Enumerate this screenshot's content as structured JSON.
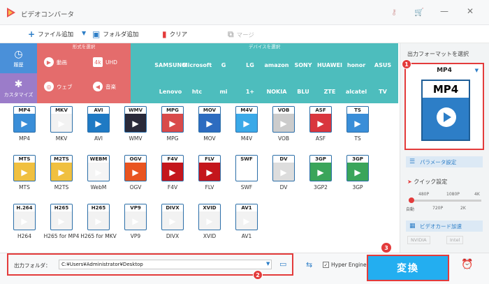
{
  "app": {
    "title": "ビデオコンバータ"
  },
  "toolbar": {
    "add_file": "ファイル追加",
    "add_folder": "フォルダ追加",
    "clear": "クリア",
    "merge": "マージ"
  },
  "side": {
    "history": "履歴",
    "custom": "カスタマイズ",
    "format_header": "形式を選択",
    "device_header": "デバイスを選択",
    "cats": [
      "動画",
      "UHD",
      "ウェブ",
      "音楽"
    ]
  },
  "brands": [
    [
      "",
      "SAMSUNG",
      "Microsoft",
      "G",
      "LG",
      "amazon",
      "SONY",
      "HUAWEI",
      "honor",
      "ASUS"
    ],
    [
      "",
      "Lenovo",
      "htc",
      "mi",
      "1+",
      "NOKIA",
      "BLU",
      "ZTE",
      "alcatel",
      "TV"
    ]
  ],
  "formats": [
    {
      "ext": "MP4",
      "label": "MP4",
      "color": "#3a8ed8"
    },
    {
      "ext": "MKV",
      "label": "MKV",
      "color": "#f2f2f2"
    },
    {
      "ext": "AVI",
      "label": "AVI",
      "color": "#1f7ac4"
    },
    {
      "ext": "WMV",
      "label": "WMV",
      "color": "#2a2a3a"
    },
    {
      "ext": "MPG",
      "label": "MPG",
      "color": "#d94a4a"
    },
    {
      "ext": "MOV",
      "label": "MOV",
      "color": "#2d6cc0"
    },
    {
      "ext": "M4V",
      "label": "M4V",
      "color": "#3aa9e8"
    },
    {
      "ext": "VOB",
      "label": "VOB",
      "color": "#cccccc"
    },
    {
      "ext": "ASF",
      "label": "ASF",
      "color": "#d9363e"
    },
    {
      "ext": "TS",
      "label": "TS",
      "color": "#3a8ed8"
    },
    {
      "ext": "MTS",
      "label": "MTS",
      "color": "#f0c040"
    },
    {
      "ext": "M2TS",
      "label": "M2TS",
      "color": "#f0c040"
    },
    {
      "ext": "WEBM",
      "label": "WebM",
      "color": "#f5f5f5"
    },
    {
      "ext": "OGV",
      "label": "OGV",
      "color": "#e95420"
    },
    {
      "ext": "F4V",
      "label": "F4V",
      "color": "#c4161c"
    },
    {
      "ext": "FLV",
      "label": "FLV",
      "color": "#c4161c"
    },
    {
      "ext": "SWF",
      "label": "SWF",
      "color": "#ffffff"
    },
    {
      "ext": "DV",
      "label": "DV",
      "color": "#dddddd"
    },
    {
      "ext": "3GP",
      "label": "3GP2",
      "color": "#3aa55a"
    },
    {
      "ext": "3GP",
      "label": "3GP",
      "color": "#3aa55a"
    },
    {
      "ext": "H.264",
      "label": "H264",
      "color": "#f2f2f2"
    },
    {
      "ext": "H265",
      "label": "H265 for MP4",
      "color": "#f2f2f2"
    },
    {
      "ext": "H265",
      "label": "H265 for MKV",
      "color": "#f2f2f2"
    },
    {
      "ext": "VP9",
      "label": "VP9",
      "color": "#f2f2f2"
    },
    {
      "ext": "DIVX",
      "label": "DIVX",
      "color": "#f2f2f2"
    },
    {
      "ext": "XVID",
      "label": "XVID",
      "color": "#f2f2f2"
    },
    {
      "ext": "AV1",
      "label": "AV1",
      "color": "#f2f2f2"
    }
  ],
  "right": {
    "title": "出力フォーマットを選択",
    "selected": "MP4",
    "param_btn": "パラメータ設定",
    "quick": "クイック設定",
    "res_top": [
      "480P",
      "1080P",
      "4K"
    ],
    "res_bottom": [
      "自動",
      "720P",
      "2K"
    ],
    "gpu_btn": "ビデオカード加速",
    "gpu_opts": [
      "NVIDIA",
      "Intel"
    ]
  },
  "bottom": {
    "out_label": "出力フォルダ：",
    "out_path": "C:¥Users¥Administrator¥Desktop",
    "hyper": "Hyper Engine",
    "convert": "変換"
  },
  "badges": [
    "1",
    "2",
    "3"
  ]
}
